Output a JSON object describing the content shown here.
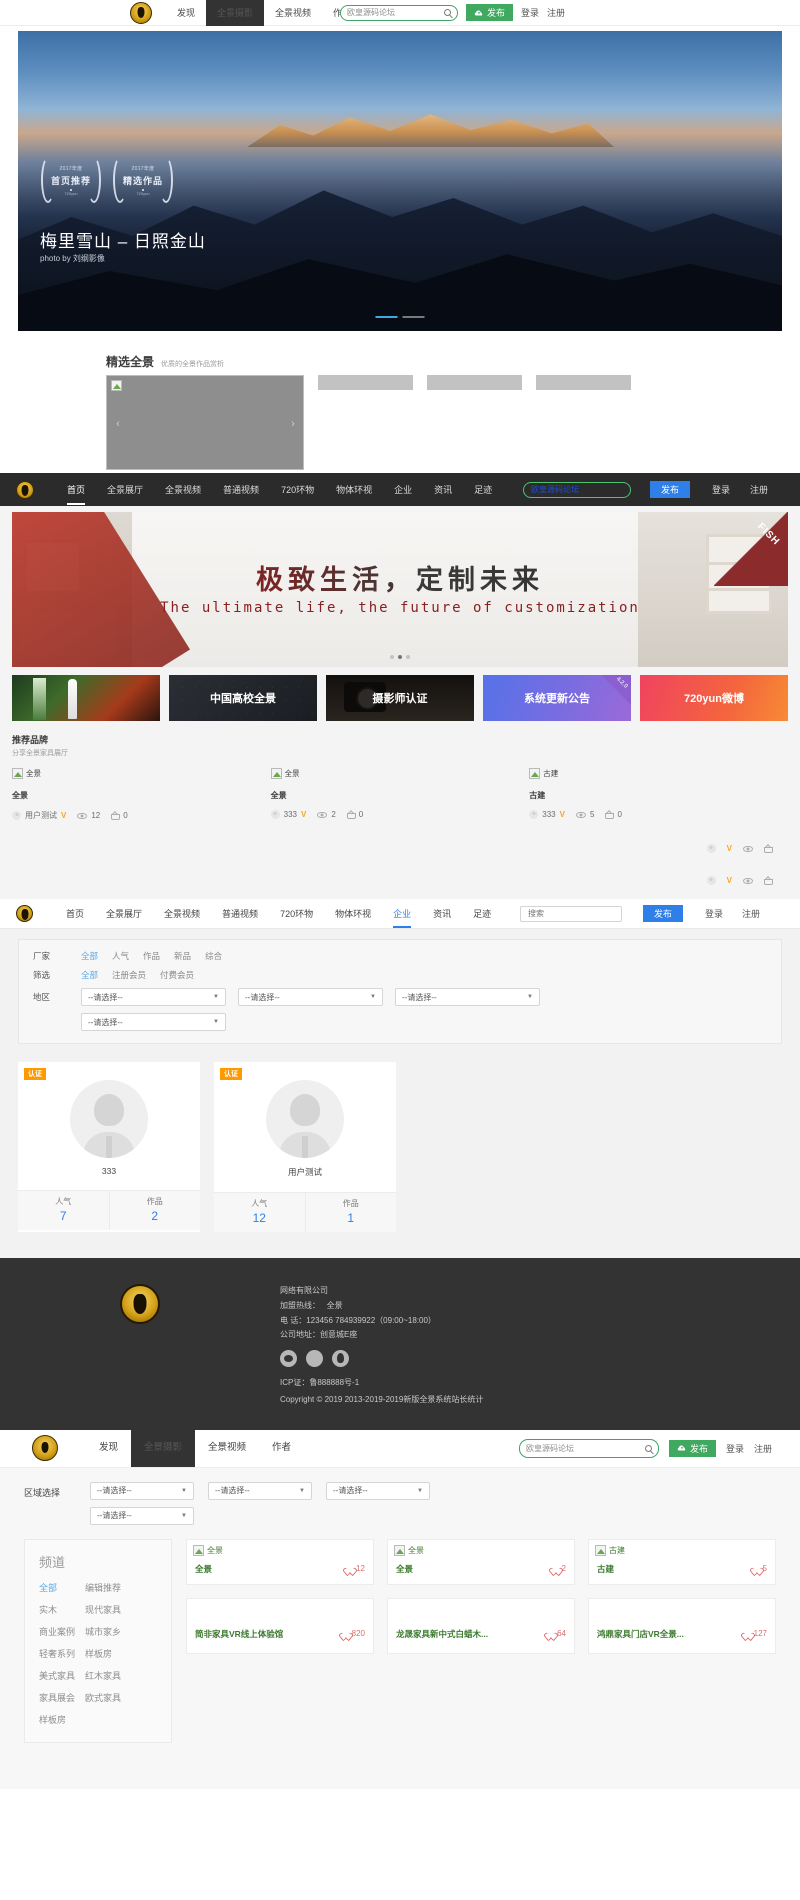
{
  "site1": {
    "nav": [
      {
        "label": "发现",
        "active": false
      },
      {
        "label": "全景摄影",
        "active": true
      },
      {
        "label": "全景视频",
        "active": false
      },
      {
        "label": "作者",
        "active": false
      }
    ],
    "search_value": "欧皇源码论坛",
    "publish_label": "发布",
    "login_label": "登录",
    "register_label": "注册",
    "hero": {
      "medals": [
        {
          "year": "2017年度",
          "title": "首页推荐",
          "sub": "720yun"
        },
        {
          "year": "2017年度",
          "title": "精选作品",
          "sub": "720yun"
        }
      ],
      "title": "梅里雪山 – 日照金山",
      "credit": "photo by 刘纲影像"
    },
    "featured": {
      "title": "精选全景",
      "subtitle": "优质的全景作品赏析",
      "image_alt": "全景"
    }
  },
  "site2": {
    "nav": [
      {
        "label": "首页",
        "active": true
      },
      {
        "label": "全景展厅",
        "active": false
      },
      {
        "label": "全景视频",
        "active": false
      },
      {
        "label": "普通视频",
        "active": false
      },
      {
        "label": "720环物",
        "active": false
      },
      {
        "label": "物体环视",
        "active": false
      },
      {
        "label": "企业",
        "active": false
      },
      {
        "label": "资讯",
        "active": false
      },
      {
        "label": "足迹",
        "active": false
      }
    ],
    "search_value": "欧皇源码论坛",
    "publish_label": "发布",
    "login_label": "登录",
    "register_label": "注册",
    "banner": {
      "cn": "极致生活，定制未来",
      "en": "The ultimate life, the future of customization",
      "corner_tag": "FISH"
    },
    "promos": [
      {
        "label": "",
        "badge": ""
      },
      {
        "label": "中国高校全景",
        "badge": ""
      },
      {
        "label": "摄影师认证",
        "badge": ""
      },
      {
        "label": "系统更新公告",
        "badge": "4.2.0"
      },
      {
        "label": "720yun微博",
        "badge": ""
      }
    ],
    "brand": {
      "title": "推荐品牌",
      "subtitle": "分享全景家具展厅",
      "items": [
        {
          "alt": "全景",
          "name": "全景",
          "author": "用户测试",
          "views": "12",
          "likes": "0"
        },
        {
          "alt": "全景",
          "name": "全景",
          "author": "333",
          "views": "2",
          "likes": "0"
        },
        {
          "alt": "古建",
          "name": "古建",
          "author": "333",
          "views": "5",
          "likes": "0"
        }
      ]
    }
  },
  "site3": {
    "nav": [
      {
        "label": "首页",
        "active": false
      },
      {
        "label": "全景展厅",
        "active": false
      },
      {
        "label": "全景视频",
        "active": false
      },
      {
        "label": "普通视频",
        "active": false
      },
      {
        "label": "720环物",
        "active": false
      },
      {
        "label": "物体环视",
        "active": false
      },
      {
        "label": "企业",
        "active": true
      },
      {
        "label": "资讯",
        "active": false
      },
      {
        "label": "足迹",
        "active": false
      }
    ],
    "search_placeholder": "搜索",
    "publish_label": "发布",
    "login_label": "登录",
    "register_label": "注册",
    "filters": {
      "row1_label": "厂家",
      "row1_options": [
        {
          "label": "全部",
          "on": true
        },
        {
          "label": "人气",
          "on": false
        },
        {
          "label": "作品",
          "on": false
        },
        {
          "label": "新品",
          "on": false
        },
        {
          "label": "综合",
          "on": false
        }
      ],
      "row2_label": "筛选",
      "row2_options": [
        {
          "label": "全部",
          "on": true
        },
        {
          "label": "注册会员",
          "on": false
        },
        {
          "label": "付费会员",
          "on": false
        }
      ],
      "row3_label": "地区",
      "select_value": "--请选择--"
    },
    "cards": [
      {
        "badge": "认证",
        "name": "333",
        "stat1_label": "人气",
        "stat1_value": "7",
        "stat2_label": "作品",
        "stat2_value": "2"
      },
      {
        "badge": "认证",
        "name": "用户测试",
        "stat1_label": "人气",
        "stat1_value": "12",
        "stat2_label": "作品",
        "stat2_value": "1"
      }
    ]
  },
  "footer": {
    "company": "网络有限公司",
    "hotline_label": "加盟热线：",
    "hotline_value": "全景",
    "phone": "电 话：123456 784939922（09:00~18:00）",
    "address": "公司地址：创意城E座",
    "socials": [
      "wechat-icon",
      "weibo-icon",
      "qq-icon"
    ],
    "icp": "ICP证：鲁888888号-1",
    "copyright": "Copyright © 2019 2013-2019-2019新版全景系统站长统计"
  },
  "site4": {
    "nav": [
      {
        "label": "发现",
        "active": false
      },
      {
        "label": "全景摄影",
        "active": true
      },
      {
        "label": "全景视频",
        "active": false
      },
      {
        "label": "作者",
        "active": false
      }
    ],
    "search_value": "欧皇源码论坛",
    "publish_label": "发布",
    "login_label": "登录",
    "register_label": "注册",
    "region": {
      "label": "区域选择",
      "select_value": "--请选择--"
    },
    "channel": {
      "title": "频道",
      "col1": [
        {
          "label": "全部",
          "on": true
        },
        {
          "label": "实木",
          "on": false
        },
        {
          "label": "商业案例",
          "on": false
        },
        {
          "label": "轻奢系列",
          "on": false
        },
        {
          "label": "美式家具",
          "on": false
        },
        {
          "label": "家具展会",
          "on": false
        },
        {
          "label": "样板房",
          "on": false
        }
      ],
      "col2": [
        {
          "label": "编辑推荐",
          "on": false
        },
        {
          "label": "现代家具",
          "on": false
        },
        {
          "label": "城市家乡",
          "on": false
        },
        {
          "label": "样板房",
          "on": false
        },
        {
          "label": "红木家具",
          "on": false
        },
        {
          "label": "欧式家具",
          "on": false
        }
      ]
    },
    "cards_row1": [
      {
        "alt": "全景",
        "title": "全景",
        "likes": "12"
      },
      {
        "alt": "全景",
        "title": "全景",
        "likes": "2"
      },
      {
        "alt": "古建",
        "title": "古建",
        "likes": "5"
      }
    ],
    "cards_row2": [
      {
        "title": "简非家具VR线上体验馆",
        "likes": "820"
      },
      {
        "title": "龙晟家具新中式白蜡木...",
        "likes": "64"
      },
      {
        "title": "鸿鼎家具门店VR全景...",
        "likes": "127"
      }
    ]
  }
}
